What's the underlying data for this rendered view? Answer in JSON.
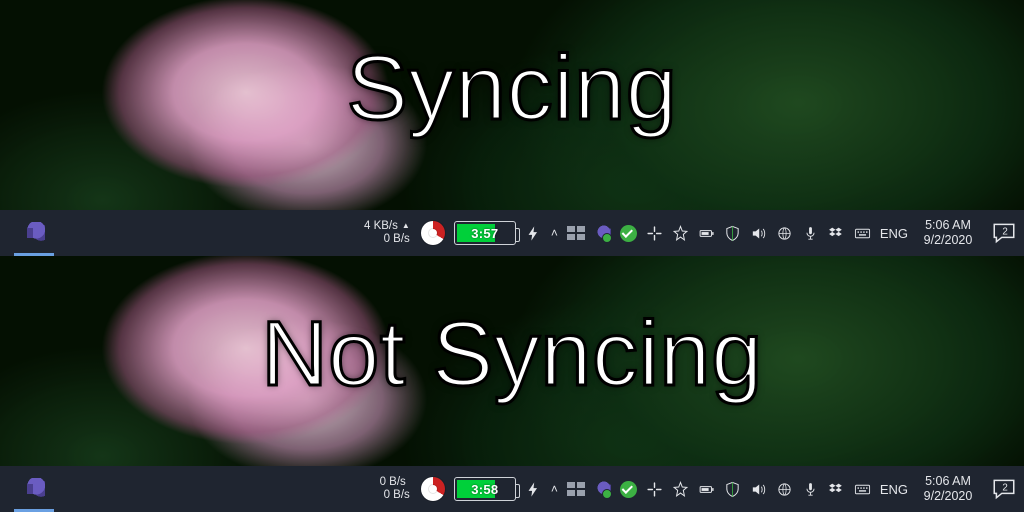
{
  "labels": {
    "syncing": "Syncing",
    "not_syncing": "Not Syncing"
  },
  "bar_top": {
    "net_down": "4 KB/s",
    "net_up_indicator": "▲",
    "net_up": "0 B/s",
    "battery_time": "3:57",
    "ime": "ENG",
    "time": "5:06 AM",
    "date": "9/2/2020",
    "action_count": "2"
  },
  "bar_bot": {
    "net_down": "0 B/s",
    "net_up_indicator": "",
    "net_up": "0 B/s",
    "battery_time": "3:58",
    "ime": "ENG",
    "time": "5:06 AM",
    "date": "9/2/2020",
    "action_count": "2"
  }
}
